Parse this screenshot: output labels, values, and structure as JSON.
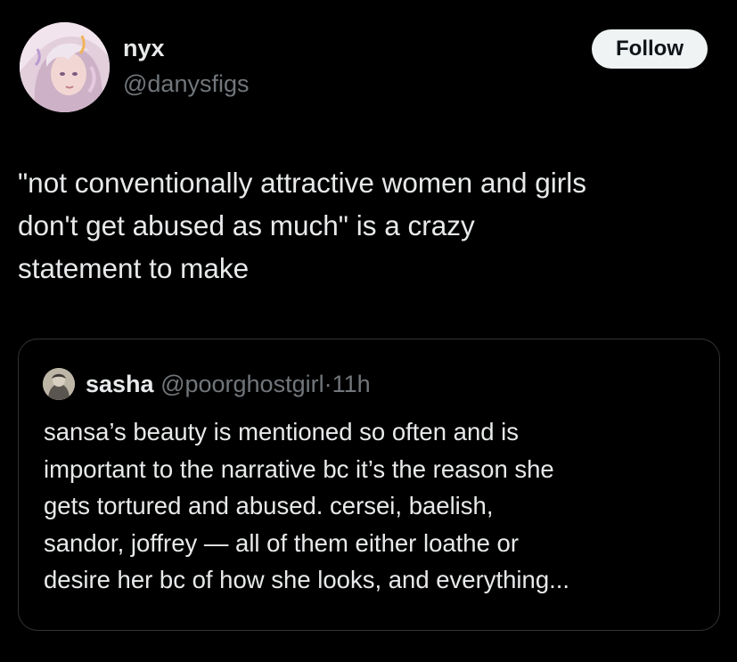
{
  "author": {
    "name": "nyx",
    "handle": "@danysfigs",
    "avatar_icon": "profile-avatar-illustration"
  },
  "follow_button": {
    "label": "Follow"
  },
  "tweet": {
    "text": "\"not conventionally attractive women and girls\ndon't get abused as much\" is a crazy\nstatement to make"
  },
  "quote": {
    "name": "sasha",
    "handle": "@poorghostgirl",
    "separator": "·",
    "time": "11h",
    "avatar_icon": "quoted-profile-avatar",
    "text": "sansa’s beauty is mentioned so often and is\nimportant to the narrative bc it’s the reason she\ngets tortured and abused. cersei, baelish,\nsandor, joffrey — all of them either loathe or\ndesire her bc of how she looks, and everything..."
  },
  "colors": {
    "background": "#000000",
    "primary_text": "#e7e9ea",
    "secondary_text": "#71767b",
    "border": "#2f3336",
    "follow_bg": "#eff3f4",
    "follow_text": "#0f1419"
  }
}
